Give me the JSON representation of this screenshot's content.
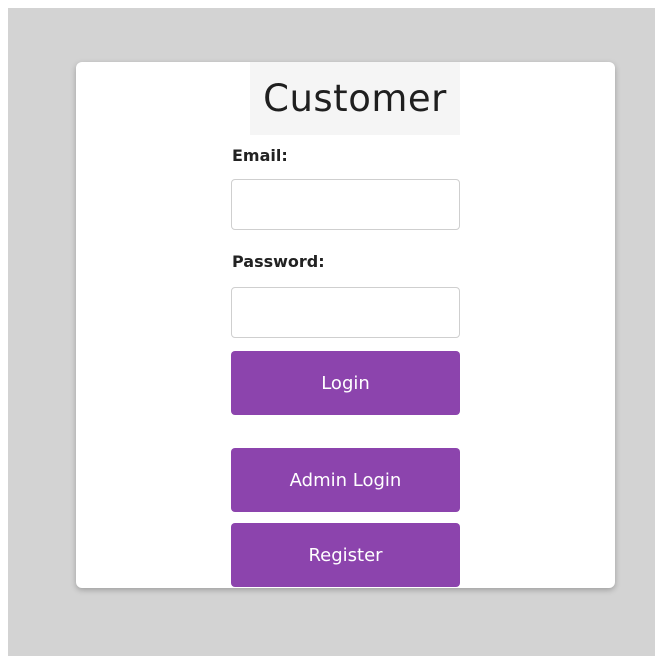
{
  "title": "Customer",
  "form": {
    "email_label": "Email:",
    "email_value": "",
    "password_label": "Password:",
    "password_value": ""
  },
  "buttons": {
    "login": "Login",
    "admin_login": "Admin Login",
    "register": "Register"
  },
  "colors": {
    "accent": "#8c44ad",
    "background": "#d3d3d3",
    "card": "#ffffff"
  }
}
